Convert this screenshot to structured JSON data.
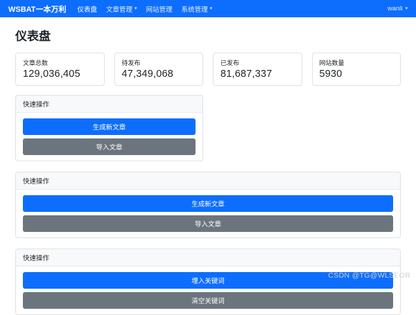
{
  "navbar": {
    "brand": "WSBAT一本万利",
    "items": [
      {
        "label": "仪表盘",
        "dropdown": false,
        "active": true
      },
      {
        "label": "文章管理",
        "dropdown": true,
        "active": false
      },
      {
        "label": "网站管理",
        "dropdown": false,
        "active": false
      },
      {
        "label": "系统管理",
        "dropdown": true,
        "active": false
      }
    ],
    "user": "wanli"
  },
  "page_title": "仪表盘",
  "stats": [
    {
      "label": "文章总数",
      "value": "129,036,405"
    },
    {
      "label": "待发布",
      "value": "47,349,068"
    },
    {
      "label": "已发布",
      "value": "81,687,337"
    },
    {
      "label": "网站数量",
      "value": "5930"
    }
  ],
  "quick_panels": [
    {
      "title": "快速操作",
      "buttons": [
        {
          "label": "生成新文章",
          "style": "primary"
        },
        {
          "label": "导入文章",
          "style": "secondary"
        }
      ]
    },
    {
      "title": "快速操作",
      "buttons": [
        {
          "label": "生成新文章",
          "style": "primary"
        },
        {
          "label": "导入文章",
          "style": "secondary"
        }
      ]
    },
    {
      "title": "快速操作",
      "buttons": [
        {
          "label": "埋入关键词",
          "style": "primary"
        },
        {
          "label": "清空关键词",
          "style": "secondary"
        }
      ]
    }
  ],
  "watermark": "CSDN @TG@WLSEOR",
  "colors": {
    "navbar": "#0d6efd",
    "primary_button": "#0d6efd",
    "secondary_button": "#6c757d"
  }
}
